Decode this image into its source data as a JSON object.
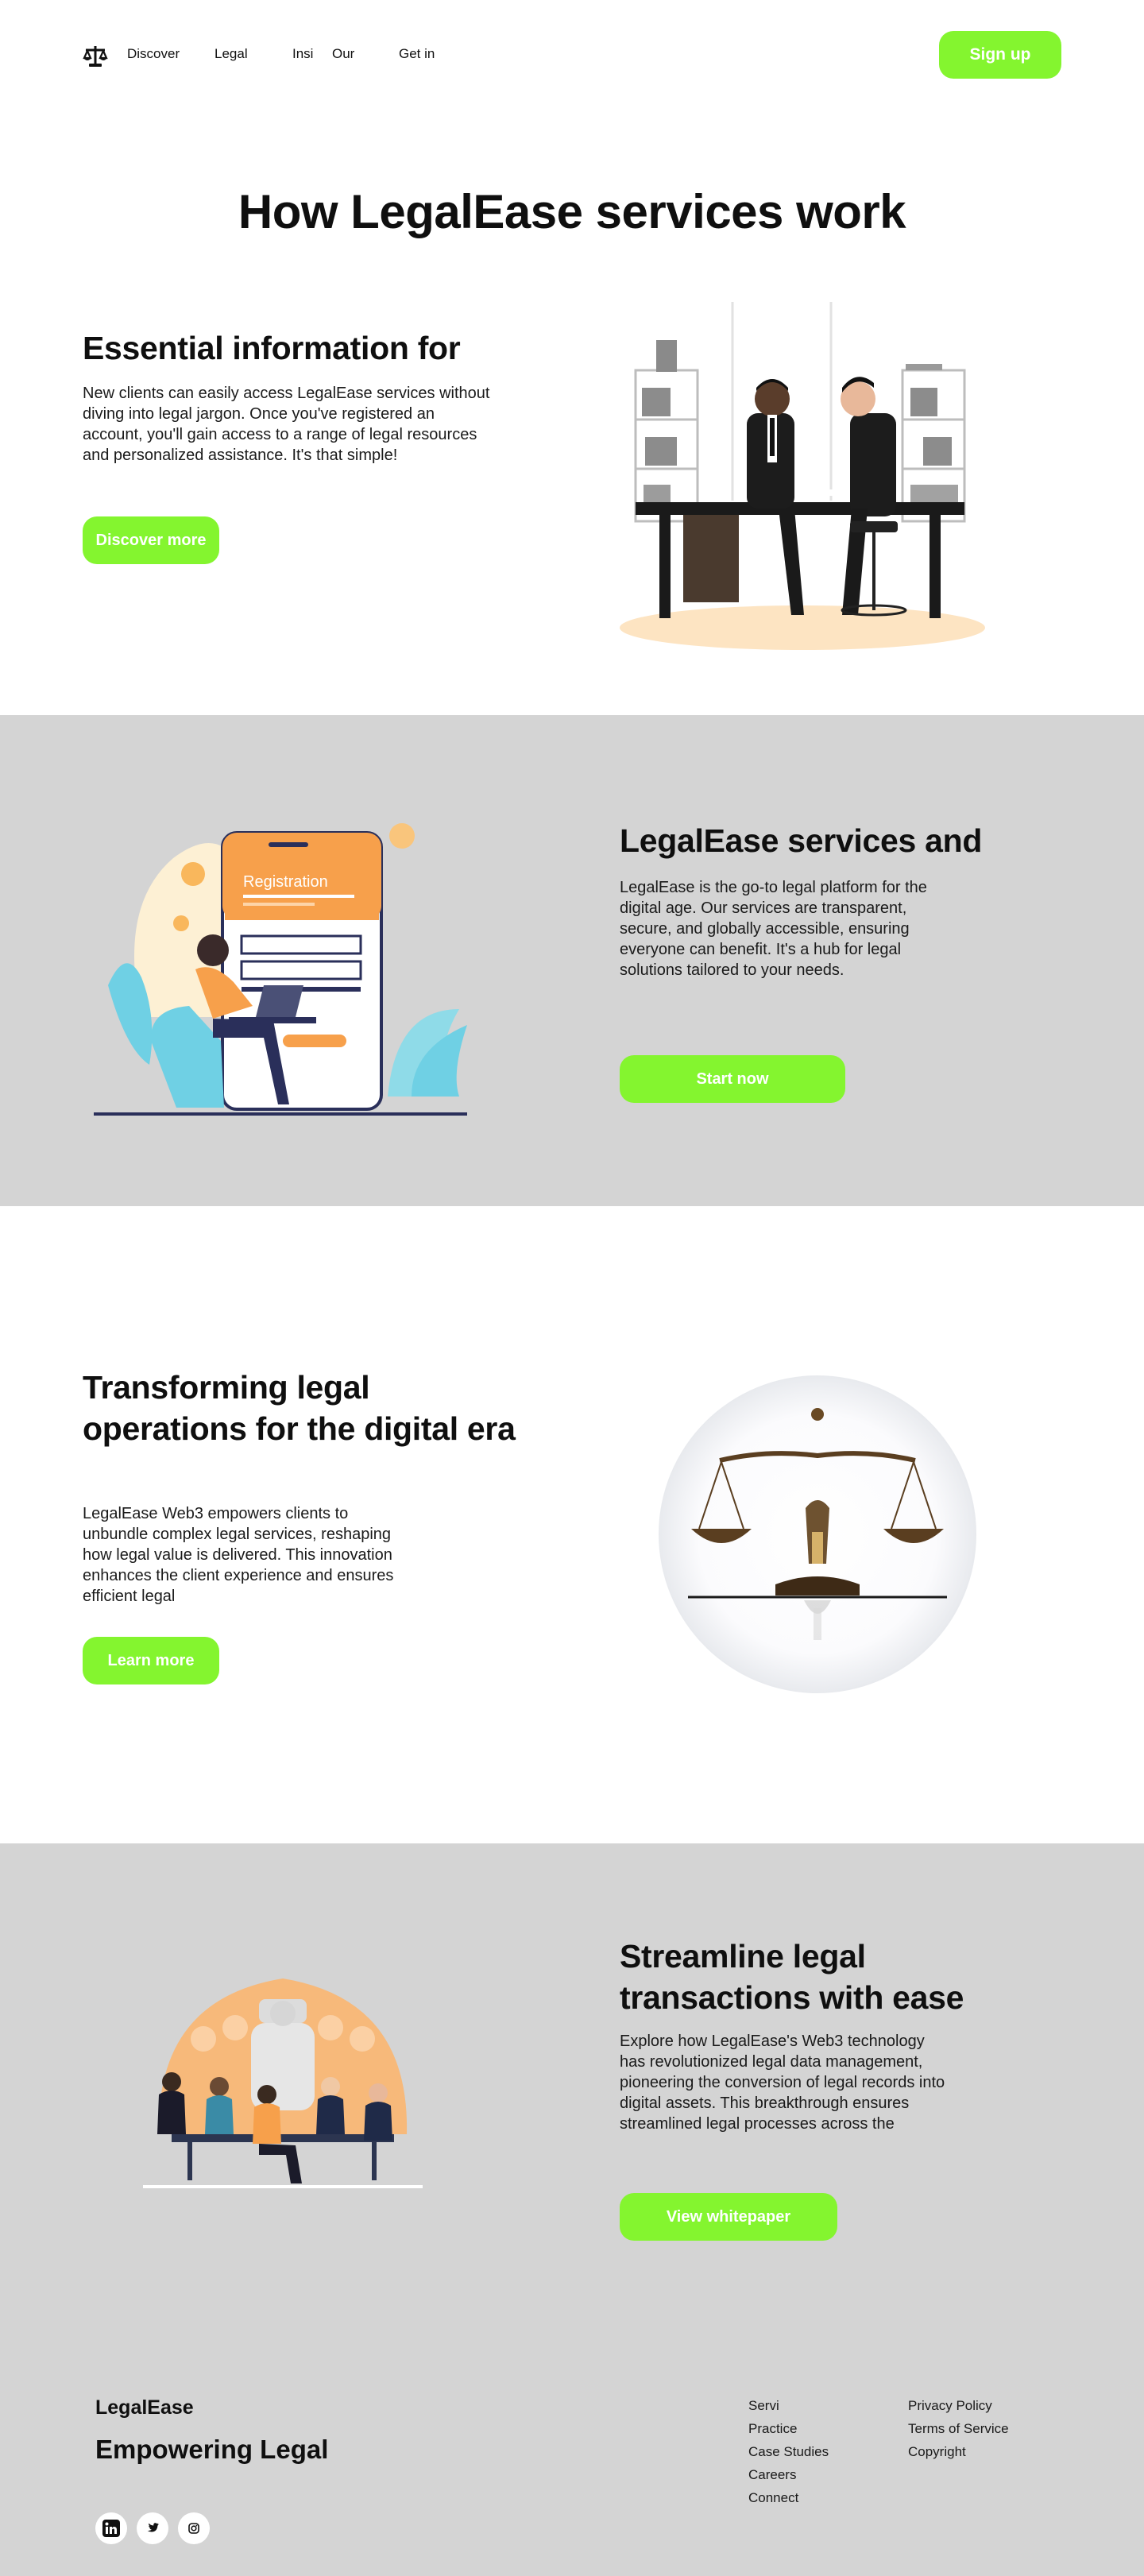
{
  "nav": {
    "links": [
      "Discover",
      "Legal",
      "Insi",
      "Our",
      "Get in"
    ],
    "signup_label": "Sign up"
  },
  "hero": {
    "title": "How LegalEase services work"
  },
  "section1": {
    "heading": "Essential information for",
    "body": "New clients can easily access LegalEase services without diving into legal jargon. Once you've registered an account, you'll gain access to a range of legal resources and personalized assistance. It's that simple!",
    "button": "Discover more"
  },
  "section2": {
    "heading": "LegalEase services and",
    "body": "LegalEase is the go-to legal platform for the digital age. Our services are transparent, secure, and globally accessible, ensuring everyone can benefit. It's a hub for legal solutions tailored to your needs.",
    "button": "Start now",
    "phone_title": "Registration"
  },
  "section3": {
    "heading": "Transforming legal operations for the digital era",
    "body": "LegalEase Web3 empowers clients to unbundle complex legal services, reshaping how legal value is delivered. This innovation enhances the client experience and ensures efficient legal",
    "button": "Learn more"
  },
  "section4": {
    "heading": "Streamline legal transactions with ease",
    "body": "Explore how LegalEase's Web3 technology has revolutionized legal data management, pioneering the conversion of legal records into digital assets. This breakthrough ensures streamlined legal processes across the",
    "button": "View whitepaper"
  },
  "footer": {
    "brand": "LegalEase",
    "tagline": "Empowering Legal",
    "col1": [
      "Servi",
      "Practice",
      "Case Studies",
      "Careers",
      "Connect"
    ],
    "col2": [
      "Privacy Policy",
      "Terms of Service",
      "Copyright"
    ],
    "social_icons": [
      "linkedin-icon",
      "twitter-icon",
      "instagram-icon"
    ]
  },
  "colors": {
    "accent": "#84f52f",
    "band": "#d4d4d4",
    "orange": "#f7a04b"
  }
}
